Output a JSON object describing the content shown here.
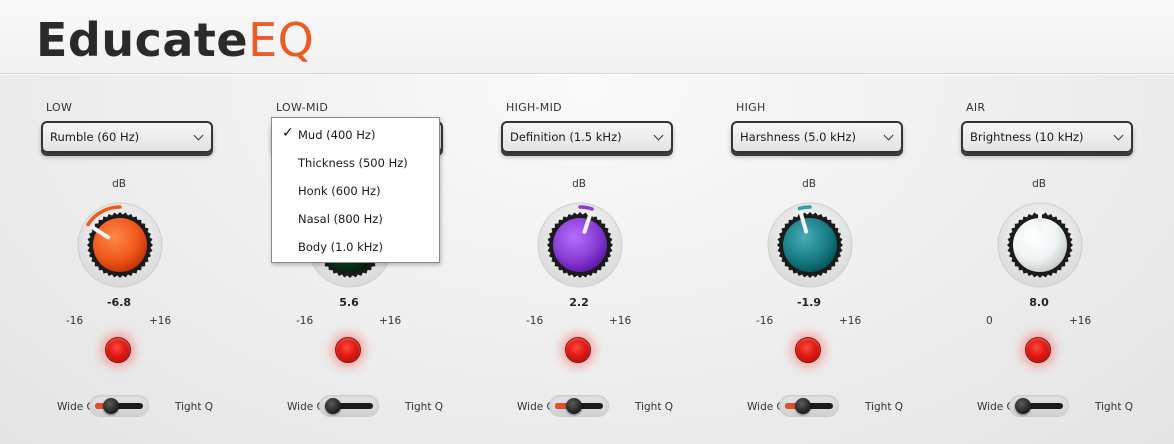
{
  "app": {
    "title_part1": "Educate",
    "title_part2": "EQ"
  },
  "labels": {
    "db": "dB",
    "wide_q": "Wide Q",
    "tight_q": "Tight Q"
  },
  "colors": {
    "brand_accent": "#ef5a22",
    "led_red": "#e01812",
    "q_fill": "#e2502a"
  },
  "bands": [
    {
      "name": "LOW",
      "selected": "Rumble (60 Hz)",
      "value": "-6.8",
      "range_min": "-16",
      "range_max": "+16",
      "knob_color": "#f05a1c",
      "arc_color": "#f05a1c",
      "knob_fraction": 0.2875,
      "q_fraction": 0.25
    },
    {
      "name": "LOW-MID",
      "selected": "Mud (400 Hz)",
      "value": "5.6",
      "range_min": "-16",
      "range_max": "+16",
      "knob_color": "#0e4a2c",
      "arc_color": "#1f8a4a",
      "knob_fraction": 0.675,
      "q_fraction": 0.0
    },
    {
      "name": "HIGH-MID",
      "selected": "Definition (1.5 kHz)",
      "value": "2.2",
      "range_min": "-16",
      "range_max": "+16",
      "knob_color": "#8a3fd4",
      "arc_color": "#8a3fd4",
      "knob_fraction": 0.56875,
      "q_fraction": 0.35
    },
    {
      "name": "HIGH",
      "selected": "Harshness (5.0 kHz)",
      "value": "-1.9",
      "range_min": "-16",
      "range_max": "+16",
      "knob_color": "#1a7f86",
      "arc_color": "#2aa0a6",
      "knob_fraction": 0.440625,
      "q_fraction": 0.3
    },
    {
      "name": "AIR",
      "selected": "Brightness (10 kHz)",
      "value": "8.0",
      "range_min": "0",
      "range_max": "+16",
      "knob_color": "#eef4f4",
      "arc_color": "#d0d8d8",
      "knob_fraction": 0.5,
      "q_fraction": 0.0
    }
  ],
  "dropdown": {
    "checkmark": "✓",
    "options": [
      "Mud (400 Hz)",
      "Thickness (500 Hz)",
      "Honk (600 Hz)",
      "Nasal (800 Hz)",
      "Body (1.0 kHz)"
    ],
    "selected_index": 0
  }
}
